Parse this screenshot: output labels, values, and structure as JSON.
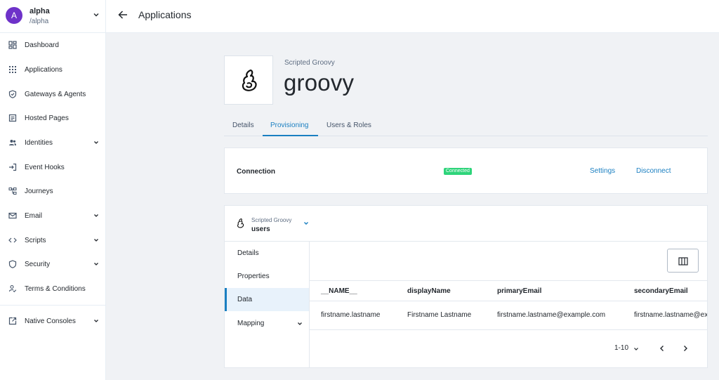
{
  "realm": {
    "initial": "A",
    "name": "alpha",
    "path": "/alpha"
  },
  "sidebar": {
    "items": [
      {
        "label": "Dashboard",
        "icon": "dashboard-icon"
      },
      {
        "label": "Applications",
        "icon": "apps-grid-icon"
      },
      {
        "label": "Gateways & Agents",
        "icon": "shield-check-icon"
      },
      {
        "label": "Hosted Pages",
        "icon": "page-icon"
      },
      {
        "label": "Identities",
        "icon": "people-icon",
        "expandable": true
      },
      {
        "label": "Event Hooks",
        "icon": "login-arrow-icon"
      },
      {
        "label": "Journeys",
        "icon": "journey-tree-icon"
      },
      {
        "label": "Email",
        "icon": "mail-icon",
        "expandable": true
      },
      {
        "label": "Scripts",
        "icon": "code-icon",
        "expandable": true
      },
      {
        "label": "Security",
        "icon": "shield-icon",
        "expandable": true
      },
      {
        "label": "Terms & Conditions",
        "icon": "person-check-icon"
      },
      {
        "label": "Native Consoles",
        "icon": "external-link-icon",
        "expandable": true
      }
    ]
  },
  "header": {
    "title": "Applications"
  },
  "app": {
    "type": "Scripted Groovy",
    "name": "groovy"
  },
  "tabs": [
    {
      "label": "Details"
    },
    {
      "label": "Provisioning",
      "active": true
    },
    {
      "label": "Users & Roles"
    }
  ],
  "connection": {
    "label": "Connection",
    "status": "Connected",
    "settings_label": "Settings",
    "disconnect_label": "Disconnect"
  },
  "object": {
    "type": "Scripted Groovy",
    "name": "users"
  },
  "subnav": [
    {
      "label": "Details"
    },
    {
      "label": "Properties"
    },
    {
      "label": "Data",
      "active": true
    },
    {
      "label": "Mapping",
      "expandable": true
    }
  ],
  "table": {
    "columns": [
      "__NAME__",
      "displayName",
      "primaryEmail",
      "secondaryEmail"
    ],
    "rows": [
      [
        "firstname.lastname",
        "Firstname Lastname",
        "firstname.lastname@example.com",
        "firstname.lastname@example.com"
      ]
    ]
  },
  "pager": {
    "range": "1-10"
  },
  "colors": {
    "accent": "#1a7fc1",
    "avatar": "#6e32c9",
    "success": "#2ed47a"
  }
}
